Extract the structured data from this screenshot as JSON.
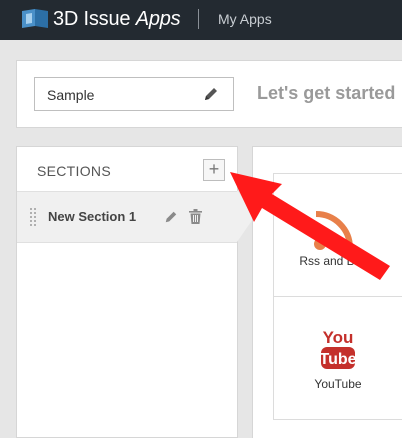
{
  "topbar": {
    "brand_prefix": "3D Issue",
    "brand_suffix": "Apps",
    "nav_link": "My Apps"
  },
  "header": {
    "app_name_value": "Sample",
    "welcome_title": "Let's get started"
  },
  "sections": {
    "title": "SECTIONS",
    "add_label": "+",
    "items": [
      {
        "label": "New Section 1"
      }
    ]
  },
  "components": [
    {
      "label": "Rss and Blogs",
      "icon": "rss-icon"
    },
    {
      "label": "YouTube",
      "icon": "youtube-icon"
    }
  ],
  "colors": {
    "topbar_bg": "#232a31",
    "accent_red": "#ff1a1a",
    "rss_orange": "#e8804a",
    "youtube_red": "#c4302b"
  }
}
